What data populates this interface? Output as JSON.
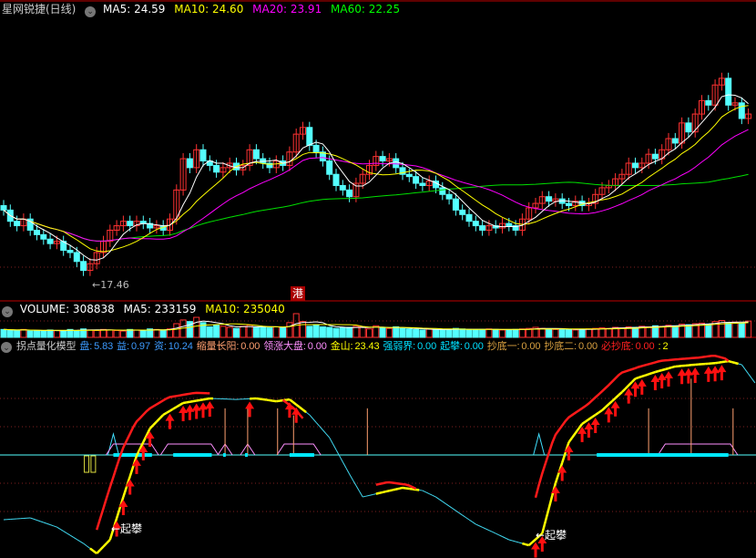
{
  "price_header": {
    "title": "星网锐捷(日线)",
    "ma5": "MA5: 24.59",
    "ma10": "MA10: 24.60",
    "ma20": "MA20: 23.91",
    "ma60": "MA60: 22.25"
  },
  "volume_header": {
    "volume": "VOLUME: 308838",
    "ma5": "MA5: 233159",
    "ma10": "MA10: 235040"
  },
  "indicator_header": {
    "title": "拐点量化模型",
    "pan": "盘: 5.83",
    "yi": "益: 0.97",
    "zi": "资: 10.24",
    "suoliang": "缩量长阳: 0.00",
    "lingzhang": "领涨大盘: 0.00",
    "jinshan": "金山: 23.43",
    "qiangruo": "强弱界: 0.00",
    "qipan": "起攀: 0.00",
    "chaodi1": "抄底一: 0.00",
    "chaodi2": "抄底二: 0.00",
    "bichaodi": "必抄底: 0.00",
    "trailing": ": 2"
  },
  "annotations": {
    "low_label": "←17.46",
    "hk_badge": "港",
    "qipan_label_1": "←起攀",
    "qipan_label_2": "←起攀"
  },
  "colors": {
    "up": "#ff3232",
    "down": "#54ffff",
    "ma5": "#ffffff",
    "ma10": "#ffff00",
    "ma20": "#ff00ff",
    "ma60": "#00e000",
    "separator": "#c00000"
  },
  "chart_data": [
    {
      "type": "candlestick",
      "title": "星网锐捷(日线)",
      "low_marker": 17.46,
      "close": [
        20.3,
        19.8,
        19.6,
        19.9,
        19.4,
        19.2,
        19.0,
        18.8,
        18.9,
        18.5,
        18.4,
        18.0,
        17.6,
        17.9,
        18.4,
        18.9,
        19.4,
        19.6,
        19.8,
        19.6,
        19.8,
        19.7,
        19.5,
        19.6,
        19.4,
        19.9,
        21.2,
        22.6,
        22.2,
        23.0,
        22.5,
        22.3,
        22.0,
        22.2,
        22.4,
        22.1,
        22.3,
        23.0,
        22.6,
        22.4,
        22.2,
        22.5,
        22.3,
        22.9,
        23.7,
        24.0,
        23.2,
        22.9,
        22.5,
        21.9,
        21.4,
        21.2,
        20.9,
        21.5,
        21.9,
        22.3,
        22.7,
        22.5,
        22.6,
        22.2,
        21.9,
        21.8,
        21.5,
        21.4,
        21.6,
        21.3,
        21.0,
        20.8,
        20.3,
        20.1,
        19.8,
        19.6,
        19.4,
        19.6,
        19.5,
        19.7,
        19.6,
        19.4,
        19.9,
        20.4,
        20.6,
        20.9,
        20.7,
        20.8,
        20.6,
        20.5,
        20.7,
        20.5,
        20.6,
        21.0,
        21.3,
        21.4,
        21.7,
        21.9,
        22.4,
        22.2,
        22.4,
        22.8,
        22.6,
        23.0,
        23.5,
        23.3,
        24.2,
        23.8,
        24.6,
        25.2,
        25.0,
        25.9,
        26.2,
        25.0,
        25.1,
        24.4,
        24.6
      ],
      "series": [
        "MA5",
        "MA10",
        "MA20",
        "MA60"
      ]
    },
    {
      "type": "bar",
      "title": "VOLUME",
      "values": [
        150000,
        140000,
        130000,
        150000,
        120000,
        130000,
        120000,
        140000,
        130000,
        120000,
        150000,
        130000,
        160000,
        140000,
        130000,
        150000,
        140000,
        130000,
        120000,
        150000,
        140000,
        130000,
        160000,
        150000,
        140000,
        160000,
        260000,
        330000,
        300000,
        380000,
        280000,
        200000,
        230000,
        210000,
        190000,
        170000,
        210000,
        230000,
        200000,
        190000,
        180000,
        200000,
        190000,
        280000,
        450000,
        300000,
        210000,
        230000,
        200000,
        190000,
        170000,
        180000,
        190000,
        210000,
        200000,
        160000,
        220000,
        180000,
        170000,
        200000,
        170000,
        160000,
        150000,
        140000,
        160000,
        150000,
        140000,
        150000,
        170000,
        160000,
        150000,
        140000,
        150000,
        160000,
        150000,
        140000,
        140000,
        150000,
        160000,
        170000,
        190000,
        170000,
        160000,
        150000,
        160000,
        150000,
        140000,
        150000,
        160000,
        170000,
        180000,
        170000,
        190000,
        180000,
        200000,
        190000,
        210000,
        200000,
        220000,
        210000,
        230000,
        220000,
        250000,
        240000,
        260000,
        270000,
        250000,
        300000,
        320000,
        280000,
        290000,
        260000,
        308838
      ]
    },
    {
      "type": "line",
      "title": "拐点量化模型",
      "main_line": [
        [
          0,
          -45.8
        ],
        [
          4,
          -44.5
        ],
        [
          8,
          -51
        ],
        [
          12,
          -62.6
        ],
        [
          14,
          -69.7
        ],
        [
          16,
          -60
        ],
        [
          18,
          -29.7
        ],
        [
          20,
          -0.6
        ],
        [
          22,
          18.7
        ],
        [
          24,
          28.4
        ],
        [
          27,
          36.8
        ],
        [
          31,
          40
        ],
        [
          35,
          39.3
        ],
        [
          38,
          40
        ],
        [
          41,
          38
        ],
        [
          43,
          39.3
        ],
        [
          46,
          28.4
        ],
        [
          49,
          12.3
        ],
        [
          52,
          -13.5
        ],
        [
          54,
          -29.7
        ],
        [
          57,
          -26.4
        ],
        [
          60,
          -23.2
        ],
        [
          63,
          -25.2
        ],
        [
          65,
          -29.7
        ],
        [
          68,
          -39.4
        ],
        [
          71,
          -49
        ],
        [
          74,
          -55.5
        ],
        [
          76,
          -60
        ],
        [
          79,
          -63.9
        ],
        [
          81,
          -55.5
        ],
        [
          83,
          -20
        ],
        [
          85,
          9
        ],
        [
          87,
          22
        ],
        [
          90,
          31.6
        ],
        [
          93,
          44.5
        ],
        [
          95,
          54
        ],
        [
          98,
          58.7
        ],
        [
          101,
          62.6
        ],
        [
          104,
          63.9
        ],
        [
          107,
          65
        ],
        [
          109,
          66.4
        ],
        [
          111,
          63.9
        ],
        [
          113,
          51
        ]
      ],
      "rising_segments": [
        [
          13,
          31
        ],
        [
          37,
          45
        ],
        [
          56,
          62
        ],
        [
          78,
          110
        ]
      ],
      "lead_line_segments": [
        [
          14,
          31
        ],
        [
          42,
          45
        ],
        [
          56,
          62
        ],
        [
          80,
          109
        ]
      ],
      "buy_arrows": [
        17,
        18,
        19,
        20,
        21,
        22,
        25,
        27,
        28,
        29,
        30,
        31,
        37,
        43,
        44,
        80,
        81,
        83,
        84,
        85,
        87,
        88,
        89,
        91,
        92,
        94,
        95,
        96,
        98,
        99,
        100,
        102,
        103,
        104,
        106,
        107,
        108
      ],
      "strong_bars": [
        [
          16.5,
          22.3
        ],
        [
          25.5,
          31.3
        ],
        [
          33,
          33.4
        ],
        [
          36.3,
          36.7
        ],
        [
          43,
          46.7
        ],
        [
          89.2,
          109
        ]
      ],
      "trapezoids": [
        [
          16.5,
          23.3
        ],
        [
          24.7,
          32.3
        ],
        [
          42.2,
          47.7
        ],
        [
          99.5,
          110.4
        ]
      ],
      "peaks": [
        33.3,
        36.7
      ],
      "triangles": [
        16.5,
        80.5
      ],
      "spikes": [
        [
          33.3,
          33
        ],
        [
          36.7,
          33
        ],
        [
          41.2,
          33
        ],
        [
          43.6,
          28
        ],
        [
          54.7,
          33
        ],
        [
          97,
          33
        ],
        [
          103.4,
          54
        ],
        [
          109.7,
          33
        ]
      ],
      "boxes": [
        12,
        13
      ],
      "gridlines": [
        40,
        20,
        0,
        -20,
        -40
      ]
    }
  ]
}
